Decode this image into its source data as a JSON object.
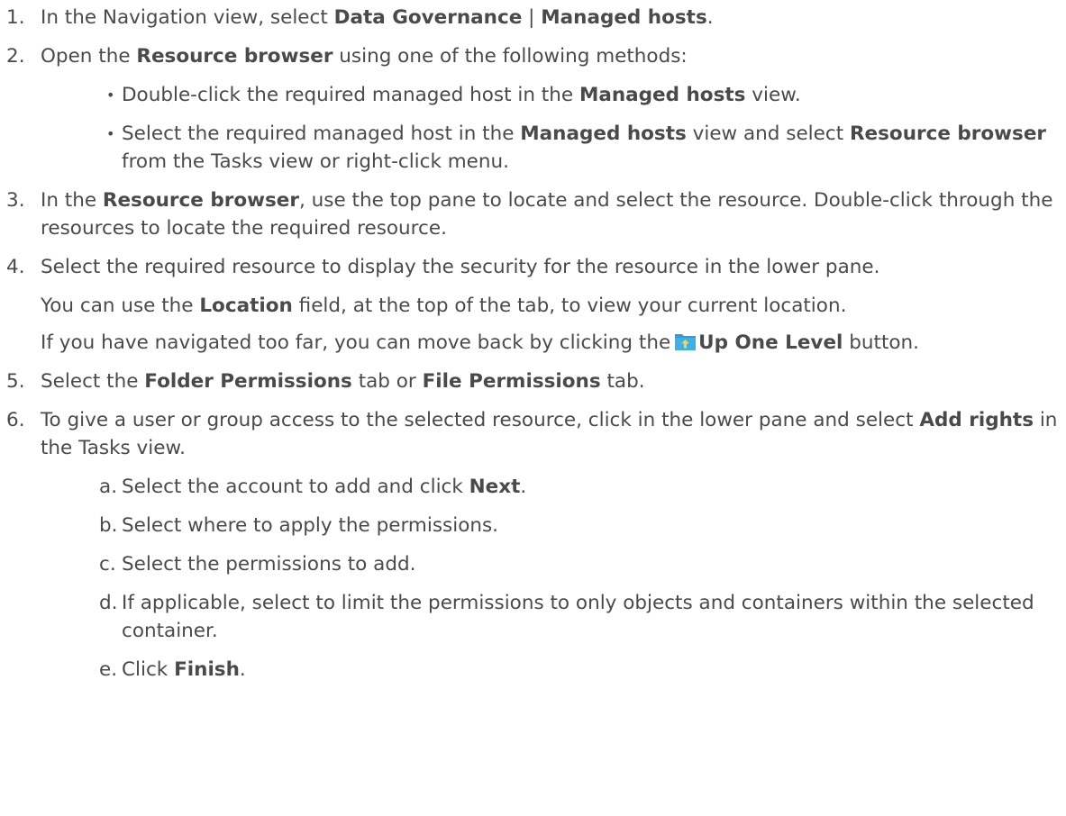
{
  "steps": [
    {
      "num": "1",
      "t0": "In the Navigation view, select ",
      "b0": "Data Governance",
      "t1": " | ",
      "b1": "Managed hosts",
      "t2": "."
    },
    {
      "num": "2",
      "t0": "Open the ",
      "b0": "Resource browser",
      "t1": " using one of the following methods:",
      "bullets": [
        {
          "t0": "Double-click the required managed host in the ",
          "b0": "Managed hosts",
          "t1": " view."
        },
        {
          "t0": "Select the required managed host in the ",
          "b0": "Managed hosts",
          "t1": " view and select ",
          "b1": "Resource browser",
          "t2": " from the Tasks view or right-click menu."
        }
      ]
    },
    {
      "num": "3",
      "t0": "In the ",
      "b0": "Resource browser",
      "t1": ", use the top pane to locate and select the resource. Double-click through the resources to locate the required resource."
    },
    {
      "num": "4",
      "t0": "Select the required resource to display the security for the resource in the lower  pane.",
      "note1": {
        "t0": "You can use the ",
        "b0": "Location",
        "t1": " field, at the top of the tab, to view your current location."
      },
      "note2": {
        "t0": "If you have navigated too far, you can move back by clicking the",
        "b0": "Up One Level",
        "t1": " button.",
        "icon": "folder-up-icon"
      }
    },
    {
      "num": "5",
      "t0": "Select the ",
      "b0": "Folder Permissions",
      "t1": " tab or ",
      "b1": "File Permissions",
      "t2": " tab."
    },
    {
      "num": "6",
      "t0": "To give a user or group access to the selected resource, click in the lower pane and select ",
      "b0": "Add rights",
      "t1": " in the Tasks view.",
      "substeps": [
        {
          "letter": "a",
          "t0": "Select the account to add and click ",
          "b0": "Next",
          "t1": "."
        },
        {
          "letter": "b",
          "t0": "Select where to apply the permissions."
        },
        {
          "letter": "c",
          "t0": "Select the permissions to add."
        },
        {
          "letter": "d",
          "t0": "If applicable, select to limit the permissions to only objects and containers within the selected container."
        },
        {
          "letter": "e",
          "t0": "Click ",
          "b0": "Finish",
          "t1": "."
        }
      ]
    }
  ],
  "colors": {
    "text": "#4a4a4a",
    "icon_folder": "#2b9fd9",
    "icon_arrow": "#ffd23f"
  }
}
